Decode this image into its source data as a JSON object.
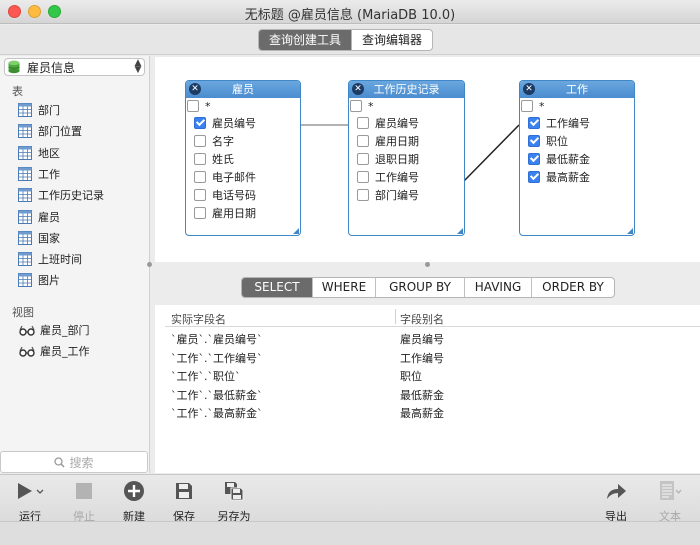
{
  "window": {
    "title": "无标题 @雇员信息 (MariaDB 10.0)"
  },
  "mode_tabs": [
    {
      "label": "查询创建工具",
      "active": true
    },
    {
      "label": "查询编辑器",
      "active": false
    }
  ],
  "sidebar": {
    "database": "雇员信息",
    "tables_header": "表",
    "tables": [
      "部门",
      "部门位置",
      "地区",
      "工作",
      "工作历史记录",
      "雇员",
      "国家",
      "上班时间",
      "图片"
    ],
    "views_header": "视图",
    "views": [
      "雇员_部门",
      "雇员_工作"
    ],
    "search_placeholder": "搜索"
  },
  "entities": [
    {
      "name": "雇员",
      "star": "*",
      "fields": [
        {
          "label": "雇员编号",
          "checked": true
        },
        {
          "label": "名字",
          "checked": false
        },
        {
          "label": "姓氏",
          "checked": false
        },
        {
          "label": "电子邮件",
          "checked": false
        },
        {
          "label": "电话号码",
          "checked": false
        },
        {
          "label": "雇用日期",
          "checked": false
        }
      ]
    },
    {
      "name": "工作历史记录",
      "star": "*",
      "fields": [
        {
          "label": "雇员编号",
          "checked": false
        },
        {
          "label": "雇用日期",
          "checked": false
        },
        {
          "label": "退职日期",
          "checked": false
        },
        {
          "label": "工作编号",
          "checked": false
        },
        {
          "label": "部门编号",
          "checked": false
        }
      ]
    },
    {
      "name": "工作",
      "star": "*",
      "fields": [
        {
          "label": "工作编号",
          "checked": true
        },
        {
          "label": "职位",
          "checked": true
        },
        {
          "label": "最低薪金",
          "checked": true
        },
        {
          "label": "最高薪金",
          "checked": true
        }
      ]
    }
  ],
  "clause_tabs": [
    {
      "label": "SELECT",
      "active": true
    },
    {
      "label": "WHERE",
      "active": false
    },
    {
      "label": "GROUP BY",
      "active": false
    },
    {
      "label": "HAVING",
      "active": false
    },
    {
      "label": "ORDER BY",
      "active": false
    }
  ],
  "grid": {
    "columns": [
      "实际字段名",
      "字段别名"
    ],
    "rows": [
      [
        "`雇员`.`雇员编号`",
        "雇员编号"
      ],
      [
        "`工作`.`工作编号`",
        "工作编号"
      ],
      [
        "`工作`.`职位`",
        "职位"
      ],
      [
        "`工作`.`最低薪金`",
        "最低薪金"
      ],
      [
        "`工作`.`最高薪金`",
        "最高薪金"
      ]
    ]
  },
  "toolbar": {
    "run": "运行",
    "stop": "停止",
    "new": "新建",
    "save": "保存",
    "save_as": "另存为",
    "export": "导出",
    "text": "文本"
  },
  "colors": {
    "accent": "#4a8cd0",
    "checkbox_on": "#3b82f0",
    "segment_active": "#6b6b6b"
  }
}
